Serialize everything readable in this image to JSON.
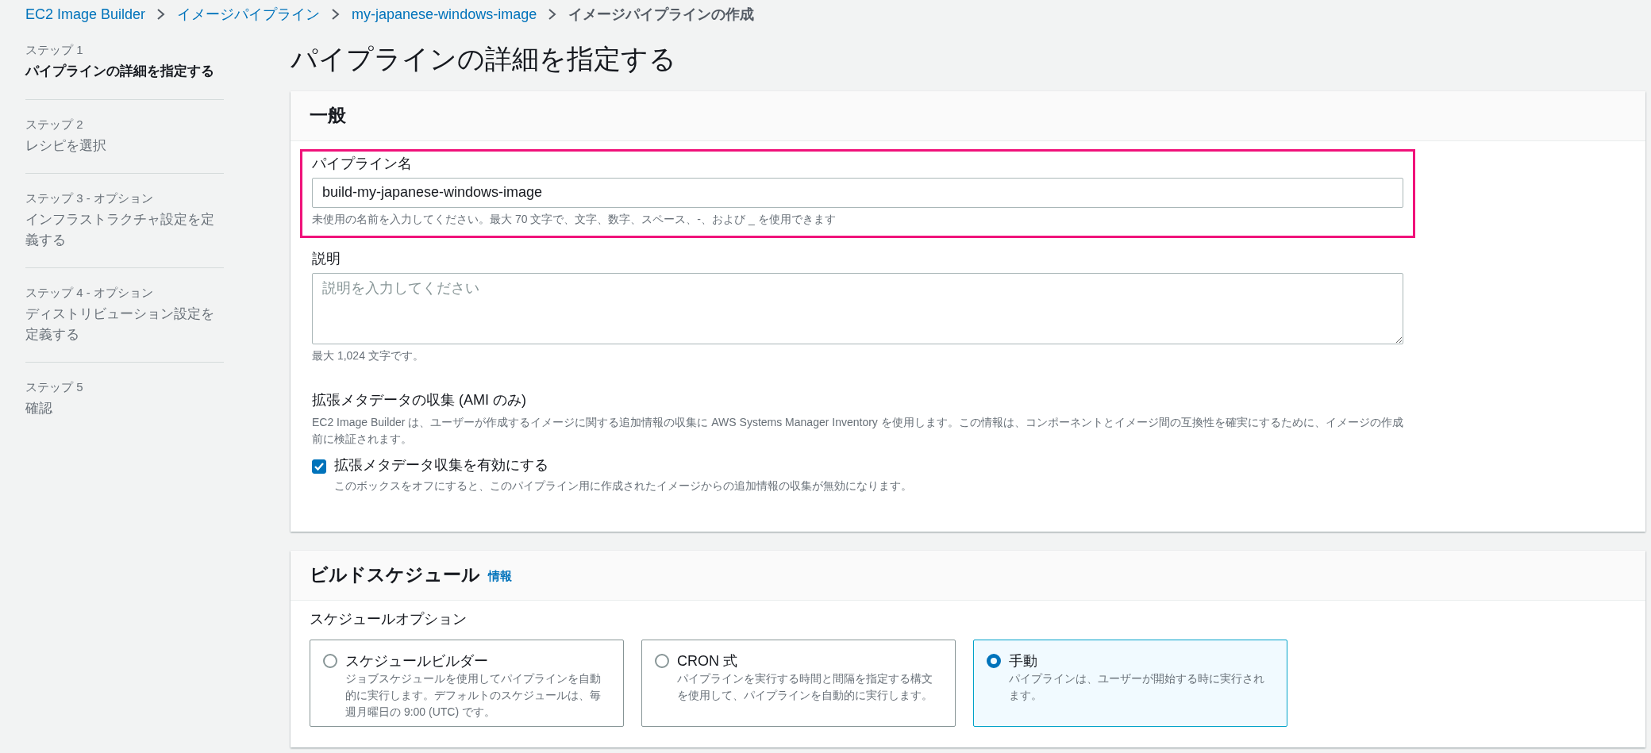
{
  "breadcrumb": [
    {
      "label": "EC2 Image Builder",
      "link": true
    },
    {
      "label": "イメージパイプライン",
      "link": true
    },
    {
      "label": "my-japanese-windows-image",
      "link": true
    },
    {
      "label": "イメージパイプラインの作成",
      "link": false
    }
  ],
  "steps": [
    {
      "step": "ステップ 1",
      "title": "パイプラインの詳細を指定する",
      "selected": true
    },
    {
      "step": "ステップ 2",
      "title": "レシピを選択",
      "selected": false
    },
    {
      "step": "ステップ 3 - オプション",
      "title": "インフラストラクチャ設定を定義する",
      "selected": false
    },
    {
      "step": "ステップ 4 - オプション",
      "title": "ディストリビューション設定を定義する",
      "selected": false
    },
    {
      "step": "ステップ 5",
      "title": "確認",
      "selected": false
    }
  ],
  "page_title": "パイプラインの詳細を指定する",
  "general": {
    "title": "一般",
    "pipeline_name": {
      "label": "パイプライン名",
      "value": "build-my-japanese-windows-image",
      "hint": "未使用の名前を入力してください。最大 70 文字で、文字、数字、スペース、-、および _ を使用できます",
      "highlighted": true
    },
    "description": {
      "label": "説明",
      "placeholder": "説明を入力してください",
      "hint": "最大 1,024 文字です。"
    },
    "metadata": {
      "label": "拡張メタデータの収集 (AMI のみ)",
      "description": "EC2 Image Builder は、ユーザーが作成するイメージに関する追加情報の収集に AWS Systems Manager Inventory を使用します。この情報は、コンポーネントとイメージ間の互換性を確実にするために、イメージの作成前に検証されます。",
      "checkbox_label": "拡張メタデータ収集を有効にする",
      "checkbox_hint": "このボックスをオフにすると、このパイプライン用に作成されたイメージからの追加情報の収集が無効になります。",
      "checked": true
    }
  },
  "build_schedule": {
    "title": "ビルドスケジュール",
    "info_link": "情報",
    "options_label": "スケジュールオプション",
    "options": [
      {
        "label": "スケジュールビルダー",
        "description": "ジョブスケジュールを使用してパイプラインを自動的に実行します。デフォルトのスケジュールは、毎週月曜日の 9:00 (UTC) です。",
        "selected": false
      },
      {
        "label": "CRON 式",
        "description": "パイプラインを実行する時間と間隔を指定する構文を使用して、パイプラインを自動的に実行します。",
        "selected": false
      },
      {
        "label": "手動",
        "description": "パイプラインは、ユーザーが開始する時に実行されます。",
        "selected": true
      }
    ]
  }
}
